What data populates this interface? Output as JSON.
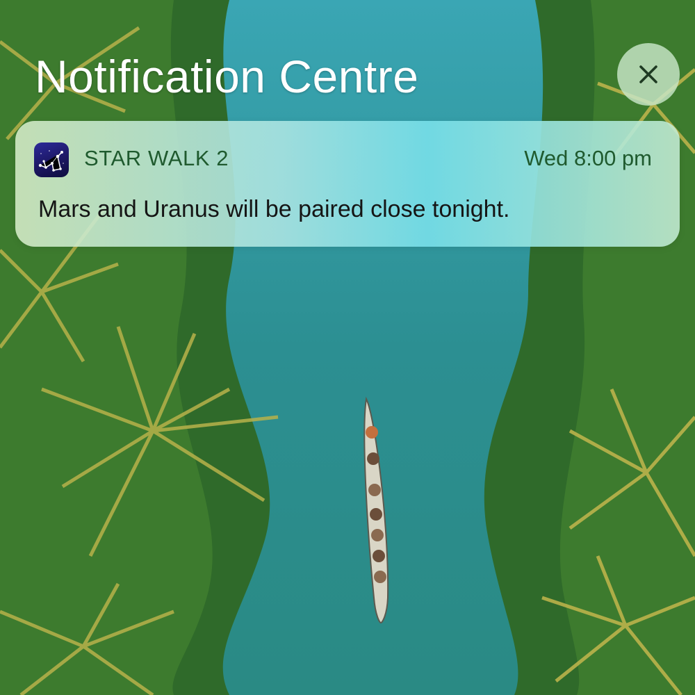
{
  "header": {
    "title": "Notification Centre",
    "close_icon": "close-icon"
  },
  "notification": {
    "app_icon": "star-walk-constellation-icon",
    "app_name": "STAR WALK 2",
    "time": "Wed 8:00 pm",
    "body": "Mars and Uranus will be paired close tonight."
  },
  "colors": {
    "title_text": "#ffffff",
    "app_label": "#1f5a2e",
    "body_text": "#151515",
    "close_button_bg": "#c8e6c8",
    "close_glyph": "#1e3a22",
    "river": "#2f8f8c",
    "foliage": "#3f7d2f"
  }
}
